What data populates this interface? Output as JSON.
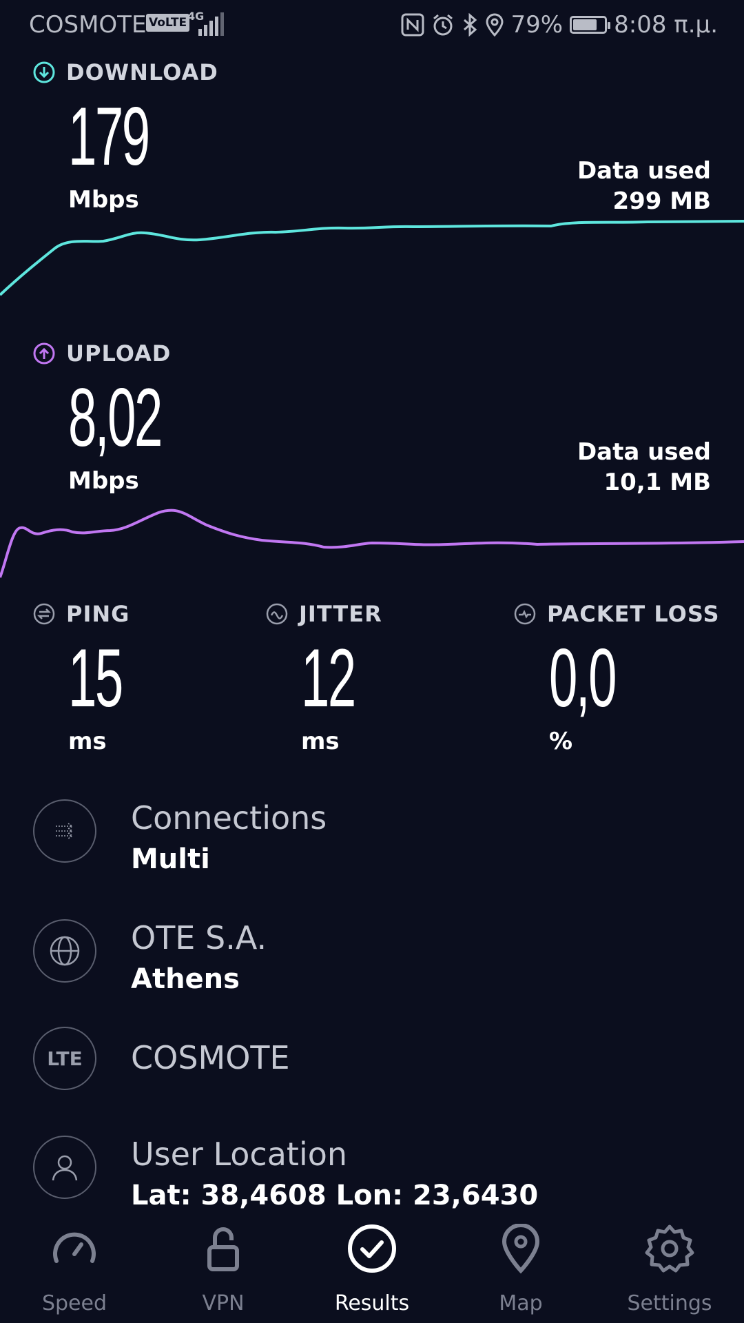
{
  "status_bar": {
    "carrier": "COSMOTE",
    "volte": "VoLTE",
    "network": "4G",
    "battery_percent": "79%",
    "battery_level": 0.79,
    "time": "8:08 π.μ."
  },
  "download": {
    "label": "DOWNLOAD",
    "value": "179",
    "unit": "Mbps",
    "data_used_label": "Data used",
    "data_used_value": "299 MB",
    "color": "#5ee6de"
  },
  "upload": {
    "label": "UPLOAD",
    "value": "8,02",
    "unit": "Mbps",
    "data_used_label": "Data used",
    "data_used_value": "10,1 MB",
    "color": "#c177f2"
  },
  "ping": {
    "label": "PING",
    "value": "15",
    "unit": "ms"
  },
  "jitter": {
    "label": "JITTER",
    "value": "12",
    "unit": "ms"
  },
  "packet_loss": {
    "label": "PACKET LOSS",
    "value": "0,0",
    "unit": "%"
  },
  "info": {
    "connections": {
      "title": "Connections",
      "value": "Multi"
    },
    "provider": {
      "title": "OTE S.A.",
      "value": "Athens"
    },
    "network": {
      "badge": "LTE",
      "title": "COSMOTE"
    },
    "location": {
      "title": "User Location",
      "value": "Lat: 38,4608 Lon: 23,6430"
    }
  },
  "nav": {
    "speed": "Speed",
    "vpn": "VPN",
    "results": "Results",
    "map": "Map",
    "settings": "Settings",
    "active": "results"
  }
}
